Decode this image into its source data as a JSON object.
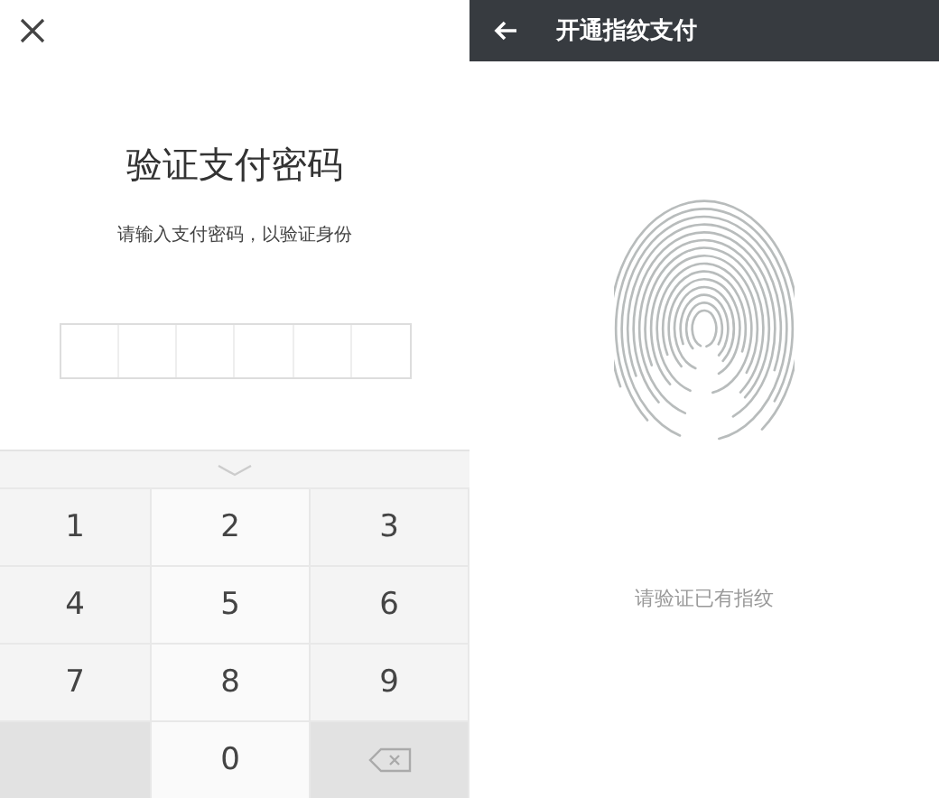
{
  "password_screen": {
    "title": "验证支付密码",
    "subtitle": "请输入支付密码，以验证身份",
    "keypad": [
      {
        "kind": "digit",
        "label": "1"
      },
      {
        "kind": "digit",
        "label": "2"
      },
      {
        "kind": "digit",
        "label": "3"
      },
      {
        "kind": "digit",
        "label": "4"
      },
      {
        "kind": "digit",
        "label": "5"
      },
      {
        "kind": "digit",
        "label": "6"
      },
      {
        "kind": "digit",
        "label": "7"
      },
      {
        "kind": "digit",
        "label": "8"
      },
      {
        "kind": "digit",
        "label": "9"
      },
      {
        "kind": "blank"
      },
      {
        "kind": "digit",
        "label": "0"
      },
      {
        "kind": "backspace"
      }
    ]
  },
  "fingerprint_screen": {
    "title": "开通指纹支付",
    "prompt": "请验证已有指纹"
  }
}
